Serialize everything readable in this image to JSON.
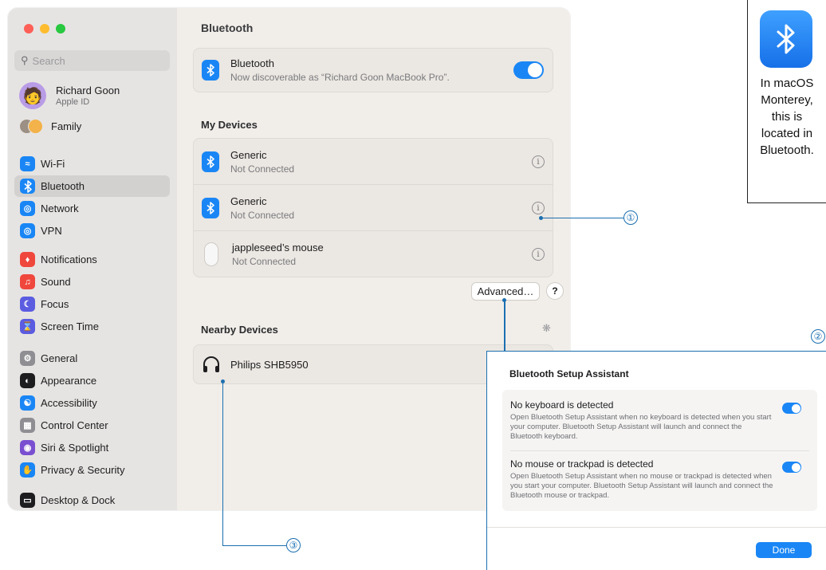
{
  "sidebar": {
    "search_placeholder": "Search",
    "account": {
      "name": "Richard Goon",
      "subtitle": "Apple ID"
    },
    "family_label": "Family",
    "groups": [
      [
        {
          "label": "Wi-Fi",
          "icon": "wifi-icon",
          "color": "#1a86f5",
          "selected": false
        },
        {
          "label": "Bluetooth",
          "icon": "bluetooth-icon",
          "color": "#1a86f5",
          "selected": true
        },
        {
          "label": "Network",
          "icon": "globe-icon",
          "color": "#1a86f5",
          "selected": false
        },
        {
          "label": "VPN",
          "icon": "vpn-globe-icon",
          "color": "#1a86f5",
          "selected": false
        }
      ],
      [
        {
          "label": "Notifications",
          "icon": "bell-icon",
          "color": "#f0473d",
          "selected": false
        },
        {
          "label": "Sound",
          "icon": "speaker-icon",
          "color": "#f0473d",
          "selected": false
        },
        {
          "label": "Focus",
          "icon": "moon-icon",
          "color": "#5b5ce0",
          "selected": false
        },
        {
          "label": "Screen Time",
          "icon": "hourglass-icon",
          "color": "#5b5ce0",
          "selected": false
        }
      ],
      [
        {
          "label": "General",
          "icon": "gear-icon",
          "color": "#8e8e93",
          "selected": false
        },
        {
          "label": "Appearance",
          "icon": "appearance-icon",
          "color": "#1d1d1f",
          "selected": false
        },
        {
          "label": "Accessibility",
          "icon": "accessibility-icon",
          "color": "#1a86f5",
          "selected": false
        },
        {
          "label": "Control Center",
          "icon": "control-center-icon",
          "color": "#8e8e93",
          "selected": false
        },
        {
          "label": "Siri & Spotlight",
          "icon": "siri-icon",
          "color": "#7a4fd0",
          "selected": false
        },
        {
          "label": "Privacy & Security",
          "icon": "hand-icon",
          "color": "#1a86f5",
          "selected": false
        }
      ],
      [
        {
          "label": "Desktop & Dock",
          "icon": "dock-icon",
          "color": "#1d1d1f",
          "selected": false
        }
      ]
    ]
  },
  "main": {
    "title": "Bluetooth",
    "bluetooth_row": {
      "title": "Bluetooth",
      "subtitle": "Now discoverable as “Richard Goon MacBook Pro”.",
      "enabled": true
    },
    "my_devices_heading": "My Devices",
    "my_devices": [
      {
        "name": "Generic",
        "status": "Not Connected",
        "icon": "bluetooth-icon"
      },
      {
        "name": "Generic",
        "status": "Not Connected",
        "icon": "bluetooth-icon"
      },
      {
        "name": "jappleseed’s mouse",
        "status": "Not Connected",
        "icon": "mouse-icon"
      }
    ],
    "advanced_button": "Advanced…",
    "help_button": "?",
    "nearby_heading": "Nearby Devices",
    "nearby_devices": [
      {
        "name": "Philips SHB5950",
        "icon": "headphones-icon"
      }
    ]
  },
  "dialog": {
    "title": "Bluetooth Setup Assistant",
    "options": [
      {
        "title": "No keyboard is detected",
        "description": "Open Bluetooth Setup Assistant when no keyboard is detected when you start your computer. Bluetooth Setup Assistant will launch and connect the Bluetooth keyboard.",
        "enabled": true
      },
      {
        "title": "No mouse or trackpad is detected",
        "description": "Open Bluetooth Setup Assistant when no mouse or trackpad is detected when you start your computer. Bluetooth Setup Assistant will launch and connect the Bluetooth mouse or trackpad.",
        "enabled": true
      }
    ],
    "done_button": "Done"
  },
  "callouts": [
    "①",
    "②",
    "③"
  ],
  "note": {
    "text": "In macOS Monterey, this is located in Bluetooth."
  },
  "colors": {
    "accent": "#1a86f5",
    "callout": "#1b6fb0"
  }
}
